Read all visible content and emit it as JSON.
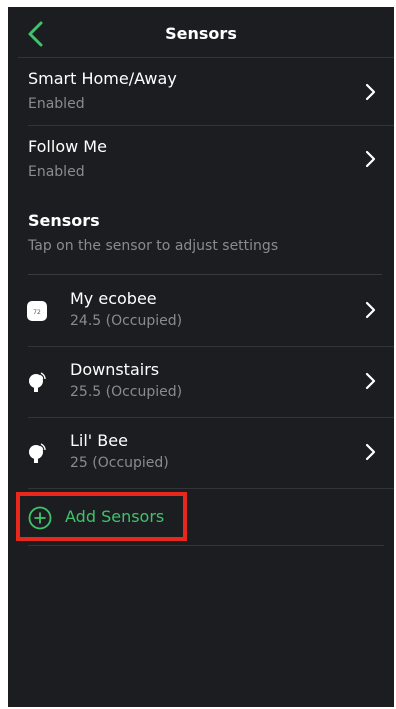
{
  "header": {
    "title": "Sensors",
    "back_icon": "chevron-left-icon"
  },
  "colors": {
    "accent": "#3fc36a",
    "highlight": "#e8281c",
    "background": "#1c1d21"
  },
  "settings": [
    {
      "title": "Smart Home/Away",
      "status": "Enabled"
    },
    {
      "title": "Follow Me",
      "status": "Enabled"
    }
  ],
  "section": {
    "title": "Sensors",
    "subtitle": "Tap on the sensor to adjust settings"
  },
  "sensors": [
    {
      "name": "My ecobee",
      "status": "24.5 (Occupied)",
      "icon": "thermostat-icon",
      "icon_text": "72"
    },
    {
      "name": "Downstairs",
      "status": "25.5 (Occupied)",
      "icon": "room-sensor-icon"
    },
    {
      "name": "Lil' Bee",
      "status": "25 (Occupied)",
      "icon": "room-sensor-icon"
    }
  ],
  "add": {
    "label": "Add Sensors",
    "icon": "plus-circle-icon"
  }
}
